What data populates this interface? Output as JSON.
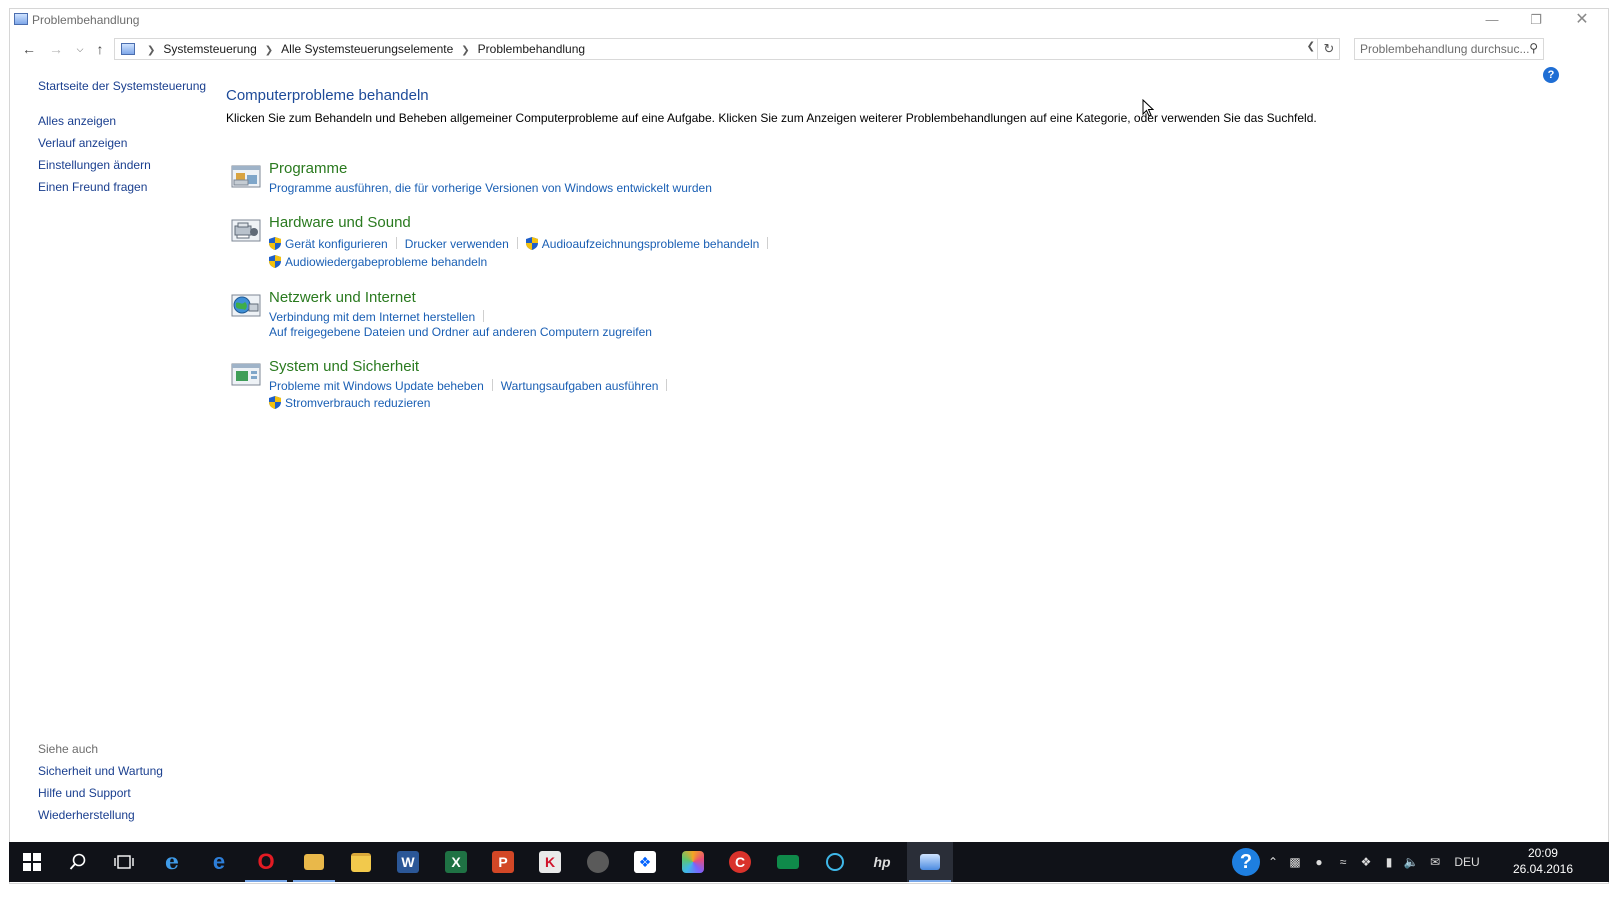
{
  "window": {
    "title": "Problembehandlung"
  },
  "nav": {
    "breadcrumb": [
      "Systemsteuerung",
      "Alle Systemsteuerungselemente",
      "Problembehandlung"
    ],
    "search_placeholder": "Problembehandlung durchsuc..."
  },
  "sidebar": {
    "home_link": "Startseite der Systemsteuerung",
    "links": [
      "Alles anzeigen",
      "Verlauf anzeigen",
      "Einstellungen ändern",
      "Einen Freund fragen"
    ],
    "see_also_title": "Siehe auch",
    "see_also_links": [
      "Sicherheit und Wartung",
      "Hilfe und Support",
      "Wiederherstellung"
    ]
  },
  "main": {
    "title": "Computerprobleme behandeln",
    "description": "Klicken Sie zum Behandeln und Beheben allgemeiner Computerprobleme auf eine Aufgabe. Klicken Sie zum Anzeigen weiterer Problembehandlungen auf eine Kategorie, oder verwenden Sie das Suchfeld.",
    "categories": [
      {
        "title": "Programme",
        "tasks": [
          "Programme ausführen, die für vorherige Versionen von Windows entwickelt wurden"
        ]
      },
      {
        "title": "Hardware und Sound",
        "tasks": [
          "Gerät konfigurieren",
          "Drucker verwenden",
          "Audioaufzeichnungsprobleme behandeln",
          "Audiowiedergabeprobleme behandeln"
        ]
      },
      {
        "title": "Netzwerk und Internet",
        "tasks": [
          "Verbindung mit dem Internet herstellen",
          "Auf freigegebene Dateien und Ordner auf anderen Computern zugreifen"
        ]
      },
      {
        "title": "System und Sicherheit",
        "tasks": [
          "Probleme mit Windows Update beheben",
          "Wartungsaufgaben ausführen",
          "Stromverbrauch reduzieren"
        ]
      }
    ]
  },
  "taskbar": {
    "language": "DEU",
    "time": "20:09",
    "date": "26.04.2016"
  },
  "colors": {
    "link": "#1a5fb4",
    "category_title": "#2a7a1f",
    "heading": "#1e4b99",
    "taskbar": "#101218"
  }
}
